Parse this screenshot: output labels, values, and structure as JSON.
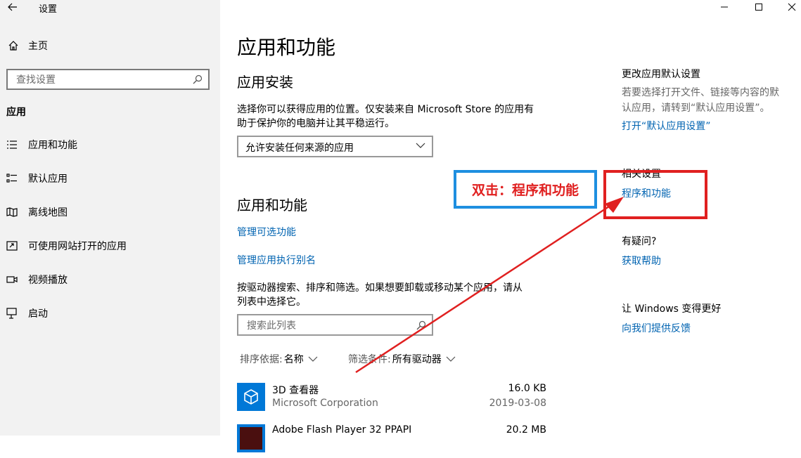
{
  "window": {
    "title": "设置"
  },
  "sidebar": {
    "home_label": "主页",
    "search_placeholder": "查找设置",
    "section_label": "应用",
    "items": [
      {
        "label": "应用和功能",
        "icon": "list-icon"
      },
      {
        "label": "默认应用",
        "icon": "default-apps-icon"
      },
      {
        "label": "离线地图",
        "icon": "map-icon"
      },
      {
        "label": "可使用网站打开的应用",
        "icon": "open-in-icon"
      },
      {
        "label": "视频播放",
        "icon": "video-icon"
      },
      {
        "label": "启动",
        "icon": "startup-icon"
      }
    ]
  },
  "main": {
    "page_title": "应用和功能",
    "install": {
      "heading": "应用安装",
      "description_line1": "选择你可以获得应用的位置。仅安装来自 Microsoft Store 的应用有",
      "description_line2": "助于保护你的电脑并让其平稳运行。",
      "selected_option": "允许安装任何来源的应用"
    },
    "apps": {
      "heading": "应用和功能",
      "link_optional": "管理可选功能",
      "link_alias": "管理应用执行别名",
      "description_line1": "按驱动器搜索、排序和筛选。如果想要卸载或移动某个应用，请从",
      "description_line2": "列表中选择它。",
      "search_placeholder": "搜索此列表",
      "sort_label": "排序依据:",
      "sort_value": "名称",
      "filter_label": "筛选条件:",
      "filter_value": "所有驱动器",
      "list": [
        {
          "name": "3D 查看器",
          "publisher": "Microsoft Corporation",
          "size": "16.0 KB",
          "date": "2019-03-08",
          "icon": "3d-viewer-icon"
        },
        {
          "name": "Adobe Flash Player 32 PPAPI",
          "publisher": "",
          "size": "20.2 MB",
          "date": "",
          "icon": "flash-icon"
        }
      ]
    }
  },
  "right": {
    "default_heading": "更改应用默认设置",
    "default_text_line1": "若要选择打开文件、链接等内容的默",
    "default_text_line2": "认应用，请转到“默认应用设置”。",
    "default_link": "打开“默认应用设置”",
    "related_heading": "相关设置",
    "related_link": "程序和功能",
    "question_heading": "有疑问?",
    "question_link": "获取帮助",
    "improve_heading": "让 Windows 变得更好",
    "improve_link": "向我们提供反馈"
  },
  "annotation": {
    "callout_text": "双击：程序和功能",
    "callout_border_color": "#1e8fe0",
    "highlight_color": "#e02020"
  },
  "colors": {
    "link": "#0063b1",
    "accent_blue": "#0078d7",
    "sidebar_bg": "#f2f2f2"
  }
}
